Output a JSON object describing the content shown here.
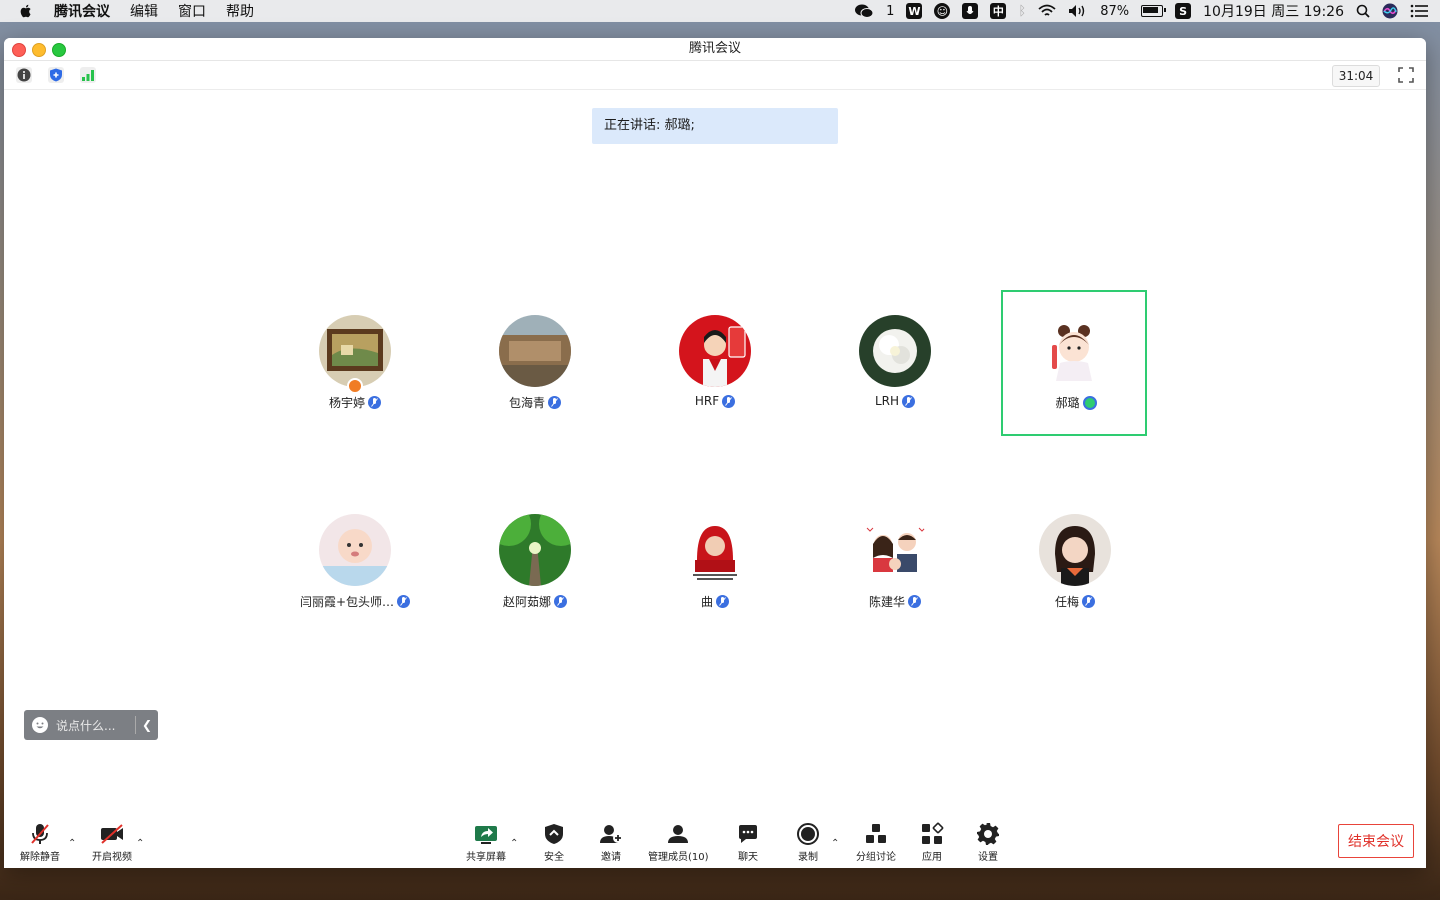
{
  "menubar": {
    "app_name": "腾讯会议",
    "menus": [
      "编辑",
      "窗口",
      "帮助"
    ],
    "wechat_count": "1",
    "status_box_w": "W",
    "status_box_zh": "中",
    "battery_percent": "87%",
    "datetime": "10月19日 周三  19:26"
  },
  "window": {
    "title": "腾讯会议",
    "timer": "31:04",
    "speaking_banner": "正在讲话: 郝璐;"
  },
  "participants": [
    {
      "name": "杨宇婷",
      "host": true
    },
    {
      "name": "包海青",
      "host": false
    },
    {
      "name": "HRF",
      "host": false
    },
    {
      "name": "LRH",
      "host": false
    },
    {
      "name": "郝璐",
      "host": false,
      "speaking": true
    },
    {
      "name": "闫丽霞+包头师…",
      "host": false
    },
    {
      "name": "赵阿茹娜",
      "host": false
    },
    {
      "name": "曲",
      "host": false
    },
    {
      "name": "陈建华",
      "host": false
    },
    {
      "name": "任梅",
      "host": false
    }
  ],
  "chat": {
    "placeholder": "说点什么..."
  },
  "bottombar": {
    "unmute": "解除静音",
    "start_video": "开启视频",
    "share_screen": "共享屏幕",
    "security": "安全",
    "invite": "邀请",
    "manage_members": "管理成员(10)",
    "chat": "聊天",
    "record": "录制",
    "breakout": "分组讨论",
    "apps": "应用",
    "settings": "设置",
    "end_meeting": "结束会议"
  },
  "colors": {
    "accent_blue": "#3b6fe0",
    "speaking_border": "#2ecc71",
    "end_red": "#e0312a",
    "banner_bg": "#dbe9fb"
  }
}
